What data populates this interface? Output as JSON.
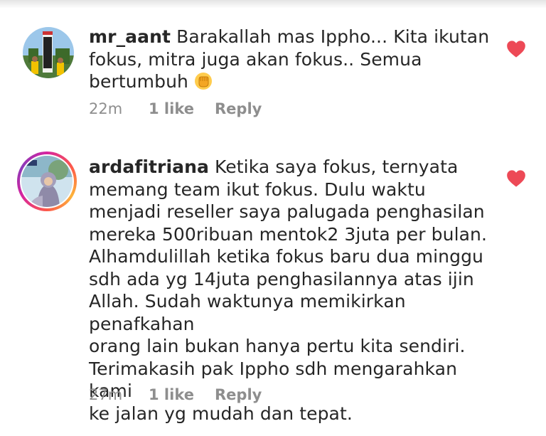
{
  "colors": {
    "heart": "#ed4956",
    "meta_text": "#8e8e8e",
    "body_text": "#262626"
  },
  "comments": [
    {
      "username": "mr_aant",
      "text_lines": [
        "Barakallah mas Ippho... Kita ikutan",
        "fokus, mitra juga akan fokus.. Semua",
        "bertumbuh"
      ],
      "emoji": "raised-fist",
      "time": "22m",
      "likes": "1 like",
      "reply": "Reply",
      "liked": true,
      "avatar_story_ring": false
    },
    {
      "username": "ardafitriana",
      "text_lines": [
        "Ketika saya fokus, ternyata",
        "memang team ikut fokus. Dulu waktu",
        "menjadi reseller saya palugada penghasilan",
        "mereka 500ribuan mentok2 3juta per bulan.",
        "Alhamdulillah ketika fokus baru dua minggu",
        "sdh ada yg 14juta penghasilannya atas ijin",
        "Allah. Sudah waktunya memikirkan penafkahan",
        "orang lain bukan hanya pertu kita sendiri.",
        "Terimakasih pak Ippho sdh mengarahkan kami",
        "ke jalan yg mudah dan tepat."
      ],
      "time": "27m",
      "likes": "1 like",
      "reply": "Reply",
      "liked": true,
      "avatar_story_ring": true
    }
  ]
}
